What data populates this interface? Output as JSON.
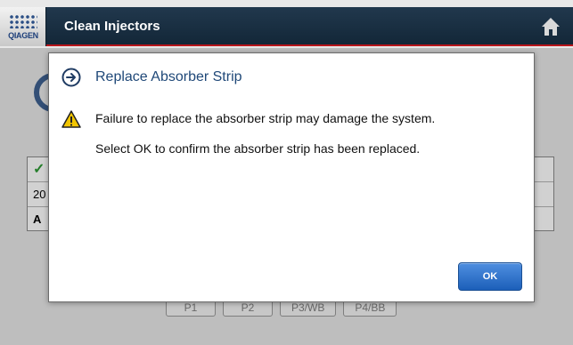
{
  "header": {
    "logo_text": "QIAGEN",
    "title": "Clean Injectors",
    "home_icon": "home-icon"
  },
  "background": {
    "table_row1_icon": "checkmark-icon",
    "table_row2_text": "20",
    "table_row3_text": "A",
    "buttons": [
      "P1",
      "P2",
      "P3/WB",
      "P4/BB"
    ]
  },
  "dialog": {
    "title_icon": "arrow-circle-right-icon",
    "title": "Replace Absorber Strip",
    "warning_icon": "warning-icon",
    "message_line1": "Failure to replace the absorber strip may damage the system.",
    "message_line2": "Select OK to confirm the absorber strip has been replaced.",
    "ok_label": "OK"
  },
  "colors": {
    "header_bg": "#1a3044",
    "header_accent": "#b8151b",
    "dialog_title": "#1f4878",
    "ok_button": "#2a6ecb",
    "warning_fill": "#f2c500"
  }
}
